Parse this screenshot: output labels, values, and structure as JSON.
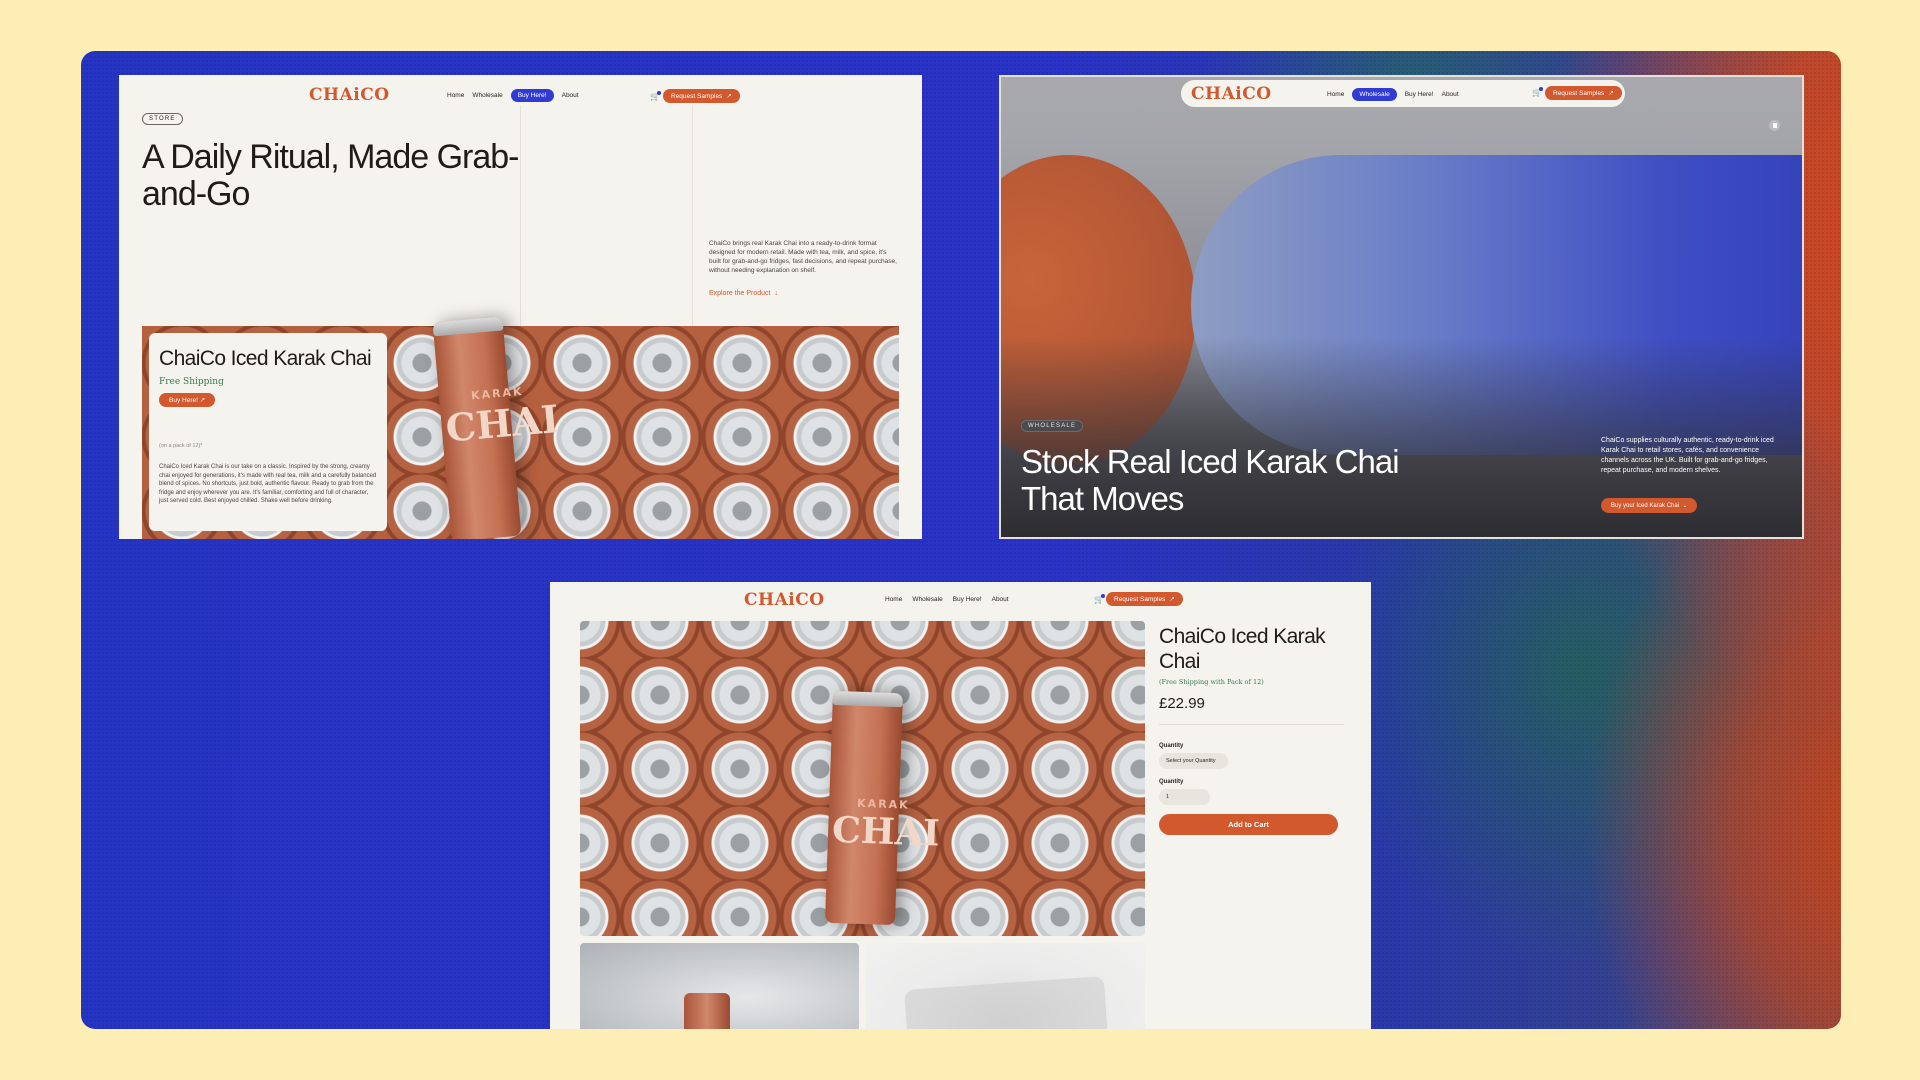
{
  "brand": {
    "logo": "CHAiCO",
    "accent": "#d2582e",
    "nav_active": "#2f3bd2",
    "green": "#357a4a"
  },
  "nav": {
    "links": [
      "Home",
      "Wholesale",
      "Buy Here!",
      "About"
    ],
    "request_label": "Request Samples",
    "arrow": "↗"
  },
  "store_page": {
    "tag": "STORE",
    "heading": "A Daily Ritual, Made Grab-and-Go",
    "description": "ChaiCo brings real Karak Chai into a ready-to-drink format designed for modern retail. Made with tea, milk, and spice, it's built for grab-and-go fridges, fast decisions, and repeat purchase, without needing explanation on shelf.",
    "explore_label": "Explore the Product",
    "card": {
      "title": "ChaiCo Iced Karak Chai",
      "shipping": "Free Shipping",
      "buy_label": "Buy Here!",
      "pack_note": "(on a pack of 12)*",
      "body": "ChaiCo Iced Karak Chai is our take on a classic. Inspired by the strong, creamy chai enjoyed for generations, it's made with real tea, milk and a carefully balanced blend of spices. No shortcuts, just bold, authentic flavour. Ready to grab from the fridge and enjoy wherever you are. It's familiar, comforting and full of character, just served cold. Best enjoyed chilled. Shake well before drinking."
    },
    "can_text": {
      "karak": "KARAK",
      "chai": "CHAI"
    }
  },
  "wholesale_page": {
    "tag": "WHOLESALE",
    "heading": "Stock Real Iced Karak Chai That Moves",
    "description": "ChaiCo supplies culturally authentic, ready-to-drink iced Karak Chai to retail stores, cafés, and convenience channels across the UK. Built for grab-and-go fridges, repeat purchase, and modern shelves.",
    "cta_label": "Buy your Iced Karak Chai",
    "cta_icon": "chevron-down-icon"
  },
  "product_page": {
    "title": "ChaiCo Iced Karak Chai",
    "shipping": "(Free Shipping with Pack of 12)",
    "price": "£22.99",
    "quantity_label_1": "Quantity",
    "select_placeholder": "Select your Quantity",
    "quantity_label_2": "Quantity",
    "quantity_value": "1",
    "add_to_cart": "Add to Cart",
    "can_text": {
      "karak": "KARAK",
      "chai": "CHAI"
    }
  }
}
